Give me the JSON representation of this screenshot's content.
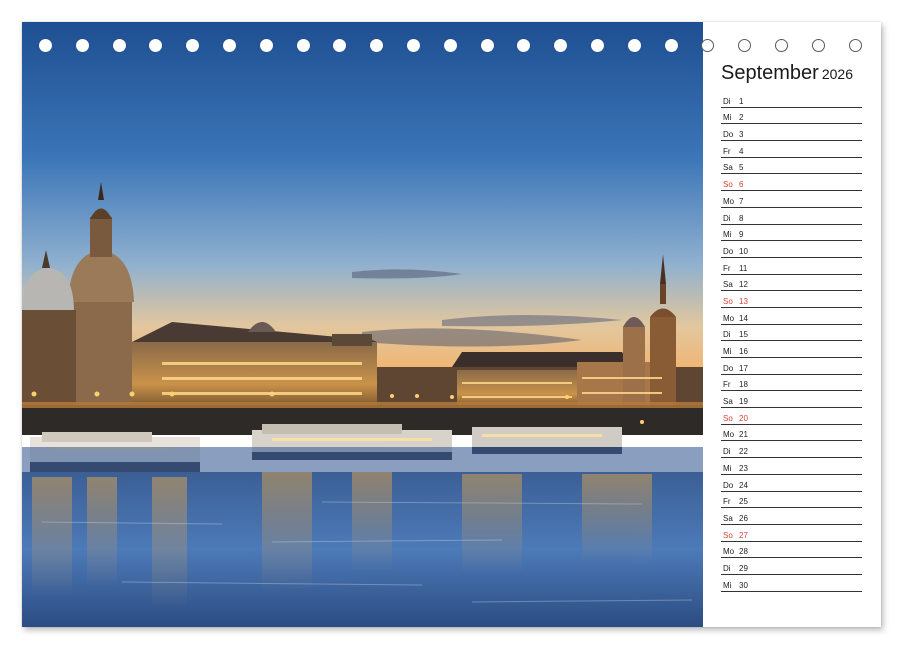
{
  "calendar": {
    "month": "September",
    "year": "2026",
    "days": [
      {
        "weekday": "Di",
        "day": "1"
      },
      {
        "weekday": "Mi",
        "day": "2"
      },
      {
        "weekday": "Do",
        "day": "3"
      },
      {
        "weekday": "Fr",
        "day": "4"
      },
      {
        "weekday": "Sa",
        "day": "5"
      },
      {
        "weekday": "So",
        "day": "6",
        "sunday": true
      },
      {
        "weekday": "Mo",
        "day": "7"
      },
      {
        "weekday": "Di",
        "day": "8"
      },
      {
        "weekday": "Mi",
        "day": "9"
      },
      {
        "weekday": "Do",
        "day": "10"
      },
      {
        "weekday": "Fr",
        "day": "11"
      },
      {
        "weekday": "Sa",
        "day": "12"
      },
      {
        "weekday": "So",
        "day": "13",
        "sunday": true
      },
      {
        "weekday": "Mo",
        "day": "14"
      },
      {
        "weekday": "Di",
        "day": "15"
      },
      {
        "weekday": "Mi",
        "day": "16"
      },
      {
        "weekday": "Do",
        "day": "17"
      },
      {
        "weekday": "Fr",
        "day": "18"
      },
      {
        "weekday": "Sa",
        "day": "19"
      },
      {
        "weekday": "So",
        "day": "20",
        "sunday": true
      },
      {
        "weekday": "Mo",
        "day": "21"
      },
      {
        "weekday": "Di",
        "day": "22"
      },
      {
        "weekday": "Mi",
        "day": "23"
      },
      {
        "weekday": "Do",
        "day": "24"
      },
      {
        "weekday": "Fr",
        "day": "25"
      },
      {
        "weekday": "Sa",
        "day": "26"
      },
      {
        "weekday": "So",
        "day": "27",
        "sunday": true
      },
      {
        "weekday": "Mo",
        "day": "28"
      },
      {
        "weekday": "Di",
        "day": "29"
      },
      {
        "weekday": "Mi",
        "day": "30"
      }
    ]
  },
  "colors": {
    "sunday": "#d6442c",
    "text": "#222222",
    "rule": "#333333"
  },
  "photo": {
    "subject": "dresden-skyline-at-dusk"
  },
  "binding": {
    "hole_count": 23
  }
}
